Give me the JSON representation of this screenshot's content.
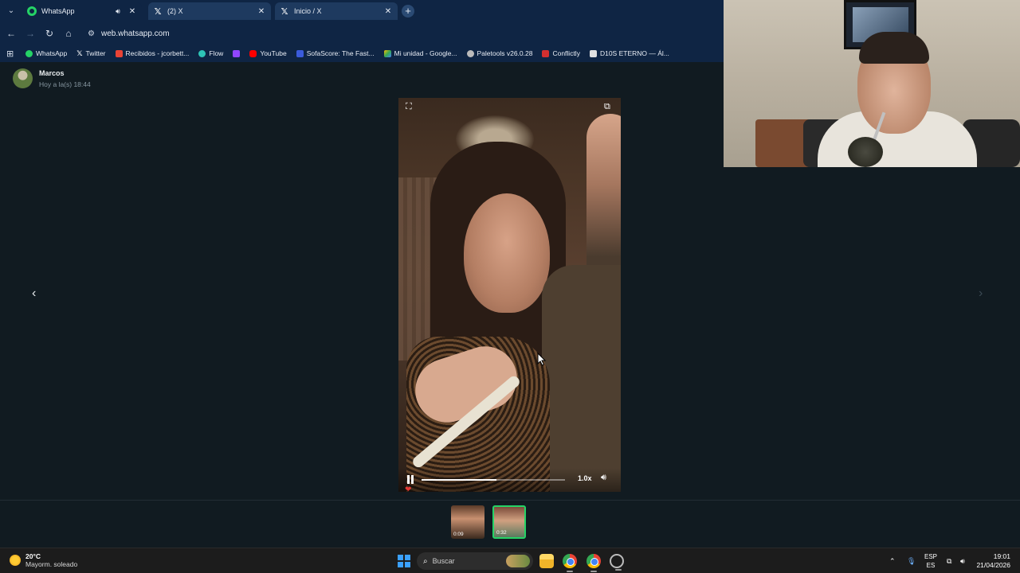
{
  "browser": {
    "tabs": [
      {
        "title": "WhatsApp",
        "favicon": "whatsapp-icon",
        "active": true,
        "audio": true
      },
      {
        "title": "(2) X",
        "favicon": "x-icon",
        "active": false
      },
      {
        "title": "Inicio / X",
        "favicon": "x-icon",
        "active": false
      }
    ],
    "url": "web.whatsapp.com",
    "bookmarks": [
      {
        "label": "WhatsApp",
        "color": "#25d366"
      },
      {
        "label": "Twitter",
        "color": "#ffffff"
      },
      {
        "label": "Recibidos - jcorbett...",
        "color": "#ea4335"
      },
      {
        "label": "Flow",
        "color": "#2ec4b6"
      },
      {
        "label": "",
        "color": "#9146ff"
      },
      {
        "label": "YouTube",
        "color": "#ff0000"
      },
      {
        "label": "SofaScore: The Fast...",
        "color": "#3b5bdb"
      },
      {
        "label": "Mi unidad - Google...",
        "color": "#fbbc05"
      },
      {
        "label": "Paletools v26.0.28",
        "color": "#bbbbbb"
      },
      {
        "label": "Conflictly",
        "color": "#d32f2f"
      },
      {
        "label": "D10S ETERNO — Ál...",
        "color": "#e0e0e0"
      }
    ]
  },
  "status": {
    "contact_name": "Marcos",
    "timestamp": "Hoy a la(s) 18:44",
    "playback_speed": "1.0x",
    "progress": 0.52,
    "thumbnails": [
      {
        "duration": "0:09",
        "selected": false
      },
      {
        "duration": "0:32",
        "selected": true
      }
    ]
  },
  "taskbar": {
    "temperature": "20°C",
    "weather": "Mayorm. soleado",
    "search_placeholder": "Buscar",
    "lang_primary": "ESP",
    "lang_secondary": "ES",
    "time": "19:01",
    "date": "21/04/2026"
  }
}
